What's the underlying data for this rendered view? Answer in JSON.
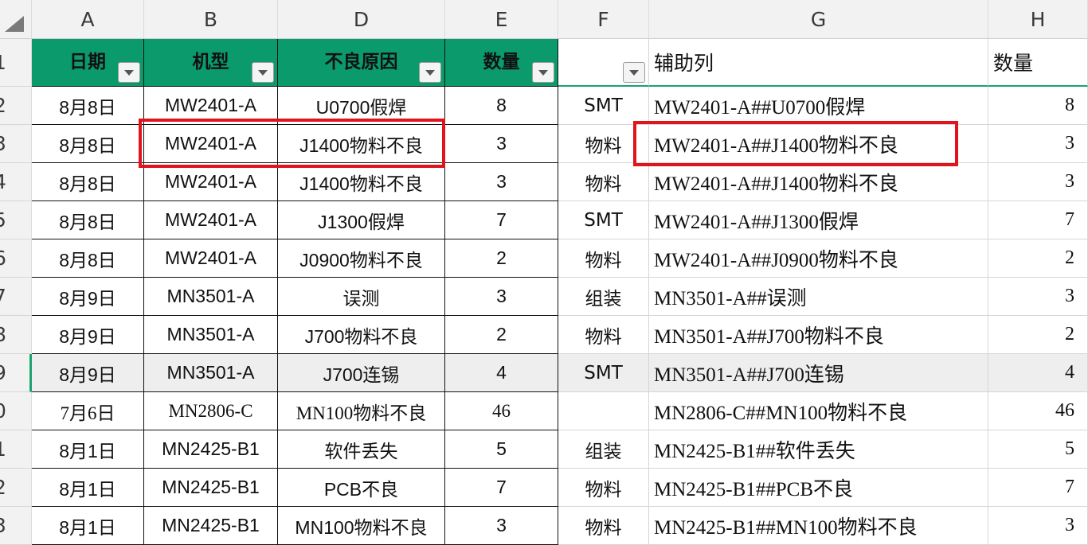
{
  "corner_icon": "select-all-triangle-icon",
  "columns": [
    "A",
    "B",
    "D",
    "E",
    "F",
    "G",
    "H"
  ],
  "row_numbers": [
    "1",
    "2",
    "3",
    "4",
    "5",
    "6",
    "7",
    "8",
    "9",
    "0",
    "1",
    "2",
    "3"
  ],
  "header": {
    "date": "日期",
    "model": "机型",
    "reason": "不良原因",
    "qty": "数量",
    "f": "",
    "helper": "辅助列",
    "h": "数量"
  },
  "filter_icon": "filter-dropdown-icon",
  "rows": [
    {
      "date": "8月8日",
      "model": "MW2401-A",
      "reason": "U0700假焊",
      "qty": "8",
      "category": "SMT",
      "helper": "MW2401-A##U0700假焊",
      "h": "8"
    },
    {
      "date": "8月8日",
      "model": "MW2401-A",
      "reason": "J1400物料不良",
      "qty": "3",
      "category": "物料",
      "helper": "MW2401-A##J1400物料不良",
      "h": "3"
    },
    {
      "date": "8月8日",
      "model": "MW2401-A",
      "reason": "J1400物料不良",
      "qty": "3",
      "category": "物料",
      "helper": "MW2401-A##J1400物料不良",
      "h": "3"
    },
    {
      "date": "8月8日",
      "model": "MW2401-A",
      "reason": "J1300假焊",
      "qty": "7",
      "category": "SMT",
      "helper": "MW2401-A##J1300假焊",
      "h": "7"
    },
    {
      "date": "8月8日",
      "model": "MW2401-A",
      "reason": "J0900物料不良",
      "qty": "2",
      "category": "物料",
      "helper": "MW2401-A##J0900物料不良",
      "h": "2"
    },
    {
      "date": "8月9日",
      "model": "MN3501-A",
      "reason": "误测",
      "qty": "3",
      "category": "组装",
      "helper": "MN3501-A##误测",
      "h": "3"
    },
    {
      "date": "8月9日",
      "model": "MN3501-A",
      "reason": "J700物料不良",
      "qty": "2",
      "category": "物料",
      "helper": "MN3501-A##J700物料不良",
      "h": "2"
    },
    {
      "date": "8月9日",
      "model": "MN3501-A",
      "reason": "J700连锡",
      "qty": "4",
      "category": "SMT",
      "helper": "MN3501-A##J700连锡",
      "h": "4"
    },
    {
      "date": "7月6日",
      "model": "MN2806-C",
      "reason": "MN100物料不良",
      "qty": "46",
      "category": "",
      "helper": "MN2806-C##MN100物料不良",
      "h": "46"
    },
    {
      "date": "8月1日",
      "model": "MN2425-B1",
      "reason": "软件丢失",
      "qty": "5",
      "category": "组装",
      "helper": "MN2425-B1##软件丢失",
      "h": "5"
    },
    {
      "date": "8月1日",
      "model": "MN2425-B1",
      "reason": "PCB不良",
      "qty": "7",
      "category": "物料",
      "helper": "MN2425-B1##PCB不良",
      "h": "7"
    },
    {
      "date": "8月1日",
      "model": "MN2425-B1",
      "reason": "MN100物料不良",
      "qty": "3",
      "category": "物料",
      "helper": "MN2425-B1##MN100物料不良",
      "h": "3"
    }
  ],
  "colors": {
    "header_green": "#0a9a6b",
    "highlight_red": "#e0141c",
    "active_row_marker": "#1aa36f"
  }
}
